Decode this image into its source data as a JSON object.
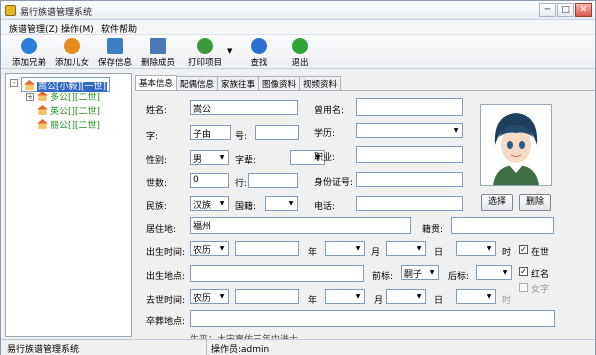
{
  "window": {
    "title": "易行族谱管理系统",
    "minimize": "─",
    "maximize": "□",
    "close": "✕"
  },
  "menu": [
    "族谱管理(Z)",
    "操作(M)",
    "软件帮助"
  ],
  "toolbar": [
    {
      "label": "添加兄弟",
      "icon": "play-icon",
      "color": "#2b7fd9"
    },
    {
      "label": "添加儿女",
      "icon": "person-icon",
      "color": "#e88b1f"
    },
    {
      "label": "保存信息",
      "icon": "pencil-icon",
      "color": "#3d7fc2"
    },
    {
      "label": "删除成员",
      "icon": "grid-icon",
      "color": "#4b79b8"
    },
    {
      "label": "打印项目",
      "icon": "wrench-icon",
      "color": "#3b9a3a"
    },
    {
      "label": "查找",
      "icon": "search-icon",
      "color": "#2b6fcf"
    },
    {
      "label": "退出",
      "icon": "arrow-right-icon",
      "color": "#2ea33a"
    }
  ],
  "tree": [
    {
      "label": "嵩公[小毅][一世]",
      "level": 0,
      "selected": true,
      "expand": "-"
    },
    {
      "label": "多公[][二世]",
      "level": 1,
      "selected": false,
      "expand": "+"
    },
    {
      "label": "英公[][二世]",
      "level": 1,
      "selected": false,
      "expand": ""
    },
    {
      "label": "丽公[][二世]",
      "level": 1,
      "selected": false,
      "expand": ""
    }
  ],
  "tabs": [
    "基本信息",
    "配偶信息",
    "家族往事",
    "图像资料",
    "视频资料"
  ],
  "form": {
    "name_label": "姓名:",
    "name_value": "嵩公",
    "alias_label": "曾用名:",
    "alias_value": "",
    "zi_label": "字:",
    "zi_value": "子由",
    "hao_label": "号:",
    "hao_value": "",
    "edu_label": "学历:",
    "edu_value": "",
    "gender_label": "性别:",
    "gender_value": "男",
    "zibei_label": "字辈:",
    "zibei_value": "",
    "job_label": "职业:",
    "job_value": "",
    "gen_label": "世数:",
    "gen_value": "0",
    "rank_label": "行:",
    "rank_value": "",
    "id_label": "身份证号:",
    "id_value": "",
    "ethnic_label": "民族:",
    "ethnic_value": "汉族",
    "nation_label": "国籍:",
    "nation_value": "",
    "phone_label": "电话:",
    "phone_value": "",
    "residence_label": "居住地:",
    "residence_value": "福州",
    "origin_label": "籍贯:",
    "origin_value": "",
    "birth_label": "出生时间:",
    "birth_cal": "农历",
    "birth_year_unit": "年",
    "birth_month_unit": "月",
    "birth_day_unit": "日",
    "birth_hour_unit": "时",
    "alive_label": "在世",
    "alive_checked": true,
    "birthplace_label": "出生地点:",
    "birthplace_value": "",
    "prefix_label": "前标:",
    "prefix_value": "嗣子",
    "suffix_label": "后标:",
    "suffix_value": "",
    "redname_label": "红名",
    "redname_checked": true,
    "death_label": "去世时间:",
    "death_cal": "农历",
    "death_year_unit": "年",
    "death_month_unit": "月",
    "death_day_unit": "日",
    "death_hour_unit": "时",
    "female_label": "女字",
    "female_checked": false,
    "burial_label": "卒葬地点:",
    "burial_value": "",
    "bio_partial": "生平：大宋嘉佑三年中进士"
  },
  "photo": {
    "select_label": "选择",
    "delete_label": "删除"
  },
  "status": {
    "app": "易行族谱管理系统",
    "operator": "操作员:admin"
  }
}
